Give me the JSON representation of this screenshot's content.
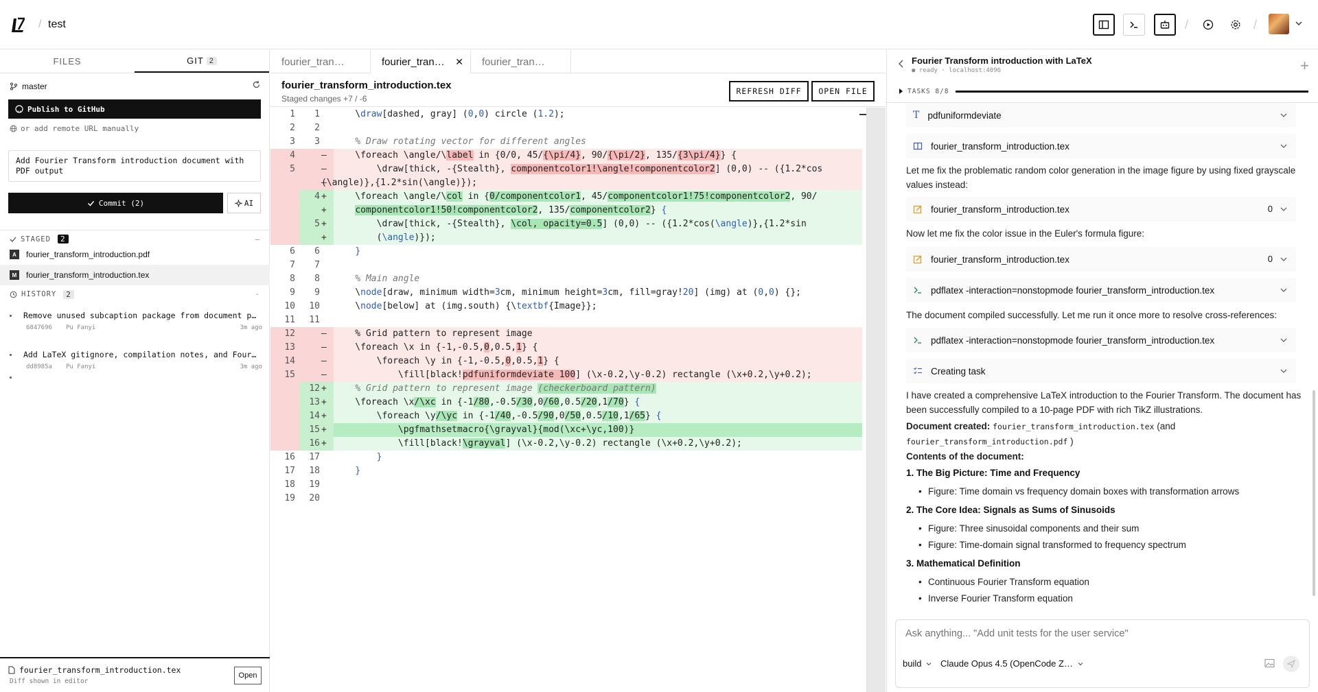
{
  "app": {
    "project": "test"
  },
  "left": {
    "tabs": [
      {
        "label": "FILES"
      },
      {
        "label": "GIT",
        "badge": "2"
      }
    ],
    "branch": "master",
    "publish_label": "Publish to GitHub",
    "remote_link": "or add remote URL manually",
    "commit_message": "Add Fourier Transform introduction document with PDF output",
    "commit_label": "Commit (2)",
    "ai_label": "AI",
    "staged": {
      "title": "STAGED",
      "count": "2",
      "files": [
        {
          "badge": "A",
          "name": "fourier_transform_introduction.pdf"
        },
        {
          "badge": "M",
          "name": "fourier_transform_introduction.tex"
        }
      ]
    },
    "history": {
      "title": "HISTORY",
      "count": "2",
      "items": [
        {
          "title": "Remove unused subcaption package from document pream…",
          "hash": "6847696",
          "author": "Pu Fanyi",
          "time": "3m ago"
        },
        {
          "title": "Add LaTeX gitignore, compilation notes, and Fourier…",
          "hash": "dd8985a",
          "author": "Pu Fanyi",
          "time": "3m ago"
        }
      ]
    },
    "footer": {
      "file": "fourier_transform_introduction.tex",
      "sub": "Diff shown in editor",
      "open_label": "Open"
    }
  },
  "editor": {
    "tabs": [
      {
        "label": "fourier_tran…"
      },
      {
        "label": "fourier_tran…"
      },
      {
        "label": "fourier_tran…"
      }
    ],
    "file": "fourier_transform_introduction.tex",
    "sub": "Staged changes  +7 / -6",
    "refresh_label": "REFRESH DIFF",
    "open_label": "OPEN FILE"
  },
  "chat": {
    "title": "Fourier Transform introduction with LaTeX",
    "status": "● ready · localhost:4096",
    "tasks": "TASKS 8/8",
    "tools": [
      {
        "icon": "text-icon",
        "label": "pdfuniformdeviate"
      },
      {
        "icon": "read-icon",
        "label": "fourier_transform_introduction.tex"
      },
      {
        "icon": "edit-icon",
        "label": "fourier_transform_introduction.tex",
        "count": "0"
      },
      {
        "icon": "edit-icon",
        "label": "fourier_transform_introduction.tex",
        "count": "0"
      },
      {
        "icon": "terminal-icon",
        "label": "pdflatex -interaction=nonstopmode fourier_transform_introduction.tex"
      },
      {
        "icon": "terminal-icon",
        "label": "pdflatex -interaction=nonstopmode fourier_transform_introduction.tex"
      },
      {
        "icon": "list-icon",
        "label": "Creating task"
      }
    ],
    "msg1": "Let me fix the problematic random color generation in the image figure by using fixed grayscale values instead:",
    "msg2": "Now let me fix the color issue in the Euler's formula figure:",
    "msg3": "The document compiled successfully. Let me run it once more to resolve cross-references:",
    "msg4": "I have created a comprehensive LaTeX introduction to the Fourier Transform. The document has been successfully compiled to a 10-page PDF with rich TikZ illustrations.",
    "doc_created_label": "Document created:",
    "doc_file1": "fourier_transform_introduction.tex",
    "doc_and": "(and",
    "doc_file2": "fourier_transform_introduction.pdf",
    "doc_close": ")",
    "contents_label": "Contents of the document:",
    "items": [
      {
        "num": "1.",
        "title": "The Big Picture: Time and Frequency",
        "bullets": [
          "Figure: Time domain vs frequency domain boxes with transformation arrows"
        ]
      },
      {
        "num": "2.",
        "title": "The Core Idea: Signals as Sums of Sinusoids",
        "bullets": [
          "Figure: Three sinusoidal components and their sum",
          "Figure: Time-domain signal transformed to frequency spectrum"
        ]
      },
      {
        "num": "3.",
        "title": "Mathematical Definition",
        "bullets": [
          "Continuous Fourier Transform equation",
          "Inverse Fourier Transform equation"
        ]
      }
    ],
    "composer_placeholder": "Ask anything... \"Add unit tests for the user service\"",
    "mode": "build",
    "model": "Claude Opus 4.5 (OpenCode Z…"
  }
}
